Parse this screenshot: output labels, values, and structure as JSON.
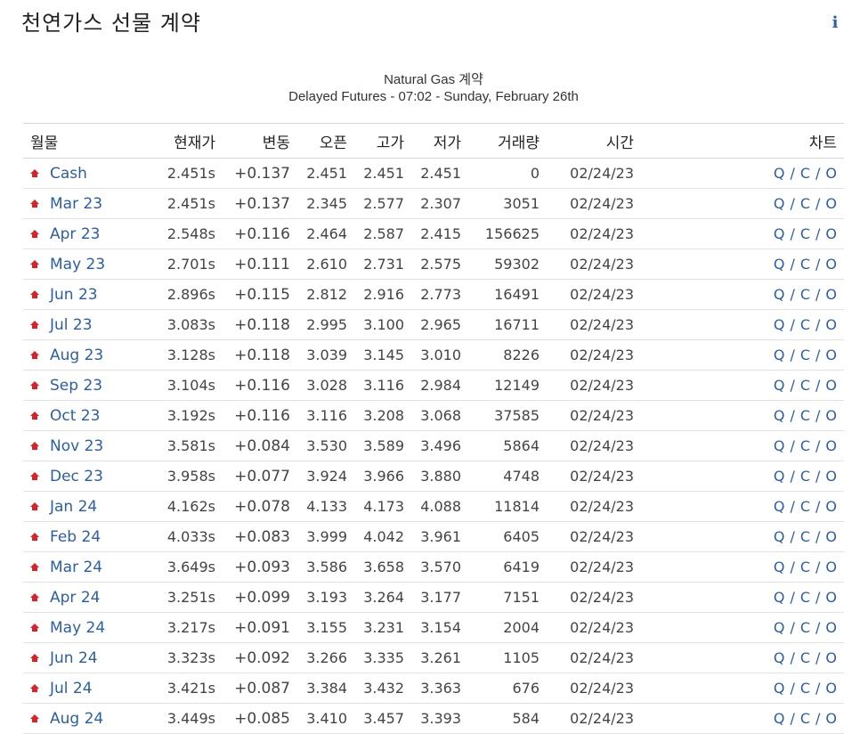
{
  "header": {
    "title": "천연가스 선물 계약",
    "info_glyph": "i"
  },
  "caption": {
    "line1": "Natural Gas 계약",
    "line2": "Delayed Futures - 07:02 - Sunday, February 26th"
  },
  "colors": {
    "link": "#2b5ea7",
    "change_up": "#e01b22"
  },
  "table": {
    "columns": {
      "month": "월물",
      "last": "현재가",
      "change": "변동",
      "open": "오픈",
      "high": "고가",
      "low": "저가",
      "volume": "거래량",
      "time": "시간",
      "chart": "차트"
    },
    "chart_links": {
      "q": "Q",
      "c": "C",
      "o": "O",
      "sep": "/"
    },
    "rows": [
      {
        "contract": "Cash",
        "last": "2.451s",
        "change": "+0.137",
        "open": "2.451",
        "high": "2.451",
        "low": "2.451",
        "volume": "0",
        "time": "02/24/23"
      },
      {
        "contract": "Mar 23",
        "last": "2.451s",
        "change": "+0.137",
        "open": "2.345",
        "high": "2.577",
        "low": "2.307",
        "volume": "3051",
        "time": "02/24/23"
      },
      {
        "contract": "Apr 23",
        "last": "2.548s",
        "change": "+0.116",
        "open": "2.464",
        "high": "2.587",
        "low": "2.415",
        "volume": "156625",
        "time": "02/24/23"
      },
      {
        "contract": "May 23",
        "last": "2.701s",
        "change": "+0.111",
        "open": "2.610",
        "high": "2.731",
        "low": "2.575",
        "volume": "59302",
        "time": "02/24/23"
      },
      {
        "contract": "Jun 23",
        "last": "2.896s",
        "change": "+0.115",
        "open": "2.812",
        "high": "2.916",
        "low": "2.773",
        "volume": "16491",
        "time": "02/24/23"
      },
      {
        "contract": "Jul 23",
        "last": "3.083s",
        "change": "+0.118",
        "open": "2.995",
        "high": "3.100",
        "low": "2.965",
        "volume": "16711",
        "time": "02/24/23"
      },
      {
        "contract": "Aug 23",
        "last": "3.128s",
        "change": "+0.118",
        "open": "3.039",
        "high": "3.145",
        "low": "3.010",
        "volume": "8226",
        "time": "02/24/23"
      },
      {
        "contract": "Sep 23",
        "last": "3.104s",
        "change": "+0.116",
        "open": "3.028",
        "high": "3.116",
        "low": "2.984",
        "volume": "12149",
        "time": "02/24/23"
      },
      {
        "contract": "Oct 23",
        "last": "3.192s",
        "change": "+0.116",
        "open": "3.116",
        "high": "3.208",
        "low": "3.068",
        "volume": "37585",
        "time": "02/24/23"
      },
      {
        "contract": "Nov 23",
        "last": "3.581s",
        "change": "+0.084",
        "open": "3.530",
        "high": "3.589",
        "low": "3.496",
        "volume": "5864",
        "time": "02/24/23"
      },
      {
        "contract": "Dec 23",
        "last": "3.958s",
        "change": "+0.077",
        "open": "3.924",
        "high": "3.966",
        "low": "3.880",
        "volume": "4748",
        "time": "02/24/23"
      },
      {
        "contract": "Jan 24",
        "last": "4.162s",
        "change": "+0.078",
        "open": "4.133",
        "high": "4.173",
        "low": "4.088",
        "volume": "11814",
        "time": "02/24/23"
      },
      {
        "contract": "Feb 24",
        "last": "4.033s",
        "change": "+0.083",
        "open": "3.999",
        "high": "4.042",
        "low": "3.961",
        "volume": "6405",
        "time": "02/24/23"
      },
      {
        "contract": "Mar 24",
        "last": "3.649s",
        "change": "+0.093",
        "open": "3.586",
        "high": "3.658",
        "low": "3.570",
        "volume": "6419",
        "time": "02/24/23"
      },
      {
        "contract": "Apr 24",
        "last": "3.251s",
        "change": "+0.099",
        "open": "3.193",
        "high": "3.264",
        "low": "3.177",
        "volume": "7151",
        "time": "02/24/23"
      },
      {
        "contract": "May 24",
        "last": "3.217s",
        "change": "+0.091",
        "open": "3.155",
        "high": "3.231",
        "low": "3.154",
        "volume": "2004",
        "time": "02/24/23"
      },
      {
        "contract": "Jun 24",
        "last": "3.323s",
        "change": "+0.092",
        "open": "3.266",
        "high": "3.335",
        "low": "3.261",
        "volume": "1105",
        "time": "02/24/23"
      },
      {
        "contract": "Jul 24",
        "last": "3.421s",
        "change": "+0.087",
        "open": "3.384",
        "high": "3.432",
        "low": "3.363",
        "volume": "676",
        "time": "02/24/23"
      },
      {
        "contract": "Aug 24",
        "last": "3.449s",
        "change": "+0.085",
        "open": "3.410",
        "high": "3.457",
        "low": "3.393",
        "volume": "584",
        "time": "02/24/23"
      }
    ]
  }
}
